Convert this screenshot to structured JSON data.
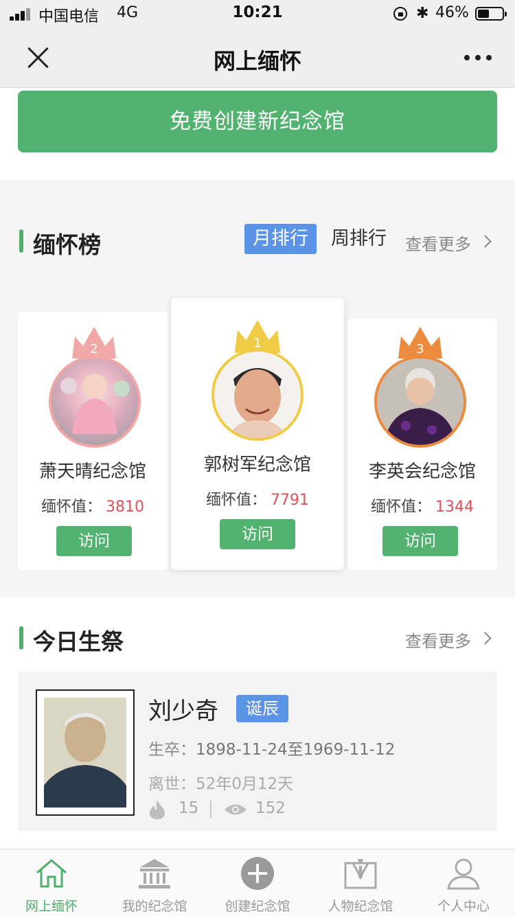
{
  "status_bar": {
    "carrier": "中国电信",
    "network": "4G",
    "time": "10:21",
    "battery": "46%",
    "battery_level": 0.46
  },
  "nav": {
    "title": "网上缅怀"
  },
  "create_button": {
    "label": "免费创建新纪念馆"
  },
  "leaderboard": {
    "title": "缅怀榜",
    "tabs": [
      {
        "label": "月排行",
        "active": true
      },
      {
        "label": "周排行",
        "active": false
      }
    ],
    "more": "查看更多",
    "cards": [
      {
        "rank": "2",
        "name": "萧天晴纪念馆",
        "score_label": "缅怀值：",
        "score": "3810",
        "visit": "访问",
        "crown_color": "#f0a7a5"
      },
      {
        "rank": "1",
        "name": "郭树军纪念馆",
        "score_label": "缅怀值：",
        "score": "7791",
        "visit": "访问",
        "crown_color": "#efcb46"
      },
      {
        "rank": "3",
        "name": "李英会纪念馆",
        "score_label": "缅怀值：",
        "score": "1344",
        "visit": "访问",
        "crown_color": "#ec8b3d"
      }
    ]
  },
  "today": {
    "title": "今日生祭",
    "more": "查看更多",
    "person": {
      "name": "刘少奇",
      "badge": "诞辰",
      "life_label": "生卒：",
      "life": "1898-11-24至1969-11-12",
      "passed_label": "离世：",
      "passed": "52年0月12天",
      "flowers": "15",
      "views": "152"
    }
  },
  "tabbar": {
    "items": [
      {
        "label": "网上缅怀",
        "icon": "home-icon",
        "active": true
      },
      {
        "label": "我的纪念馆",
        "icon": "memorial-hall-icon",
        "active": false
      },
      {
        "label": "创建纪念馆",
        "icon": "plus-circle-icon",
        "active": false
      },
      {
        "label": "人物纪念馆",
        "icon": "suit-icon",
        "active": false
      },
      {
        "label": "个人中心",
        "icon": "user-icon",
        "active": false
      }
    ]
  },
  "colors": {
    "green": "#52b26f",
    "blue": "#5b93e6",
    "red_num": "#e0505a"
  }
}
